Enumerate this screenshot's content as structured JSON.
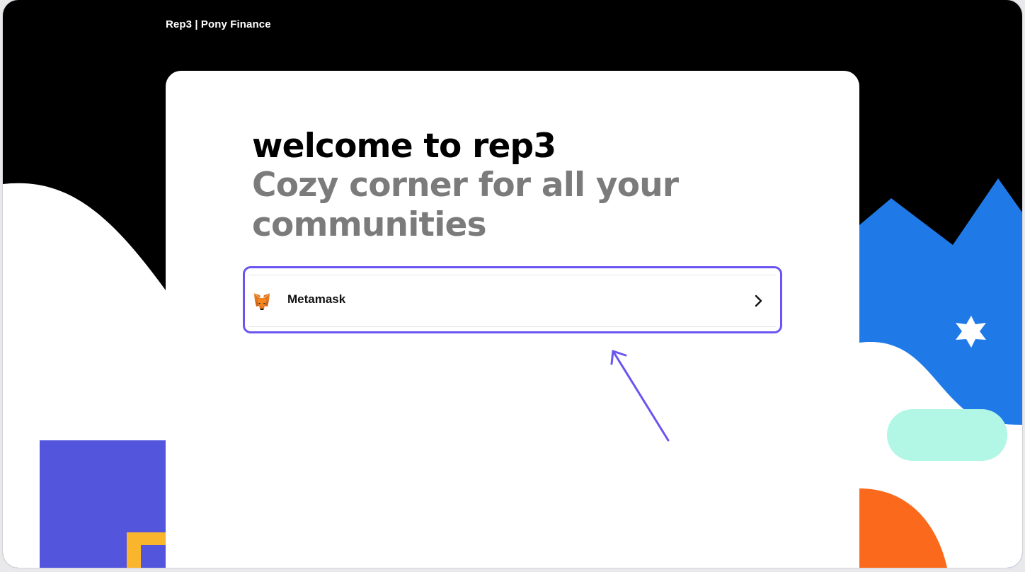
{
  "header": {
    "brand": "Rep3 | Pony Finance"
  },
  "welcome": {
    "title": "welcome to rep3",
    "subtitle_line1": "Cozy corner for all your",
    "subtitle_line2": "communities"
  },
  "wallets": [
    {
      "label": "Metamask",
      "icon": "metamask-fox-icon"
    }
  ],
  "colors": {
    "background": "#000000",
    "card": "#ffffff",
    "highlight": "#6a55f2",
    "subtitle": "#7b7b7b",
    "blue_mountain": "#1f7ae8",
    "indigo_block": "#5356dd",
    "mint_pill": "#b2f7e6",
    "orange_circle": "#fb6a1c",
    "yellow": "#f9b52c"
  }
}
